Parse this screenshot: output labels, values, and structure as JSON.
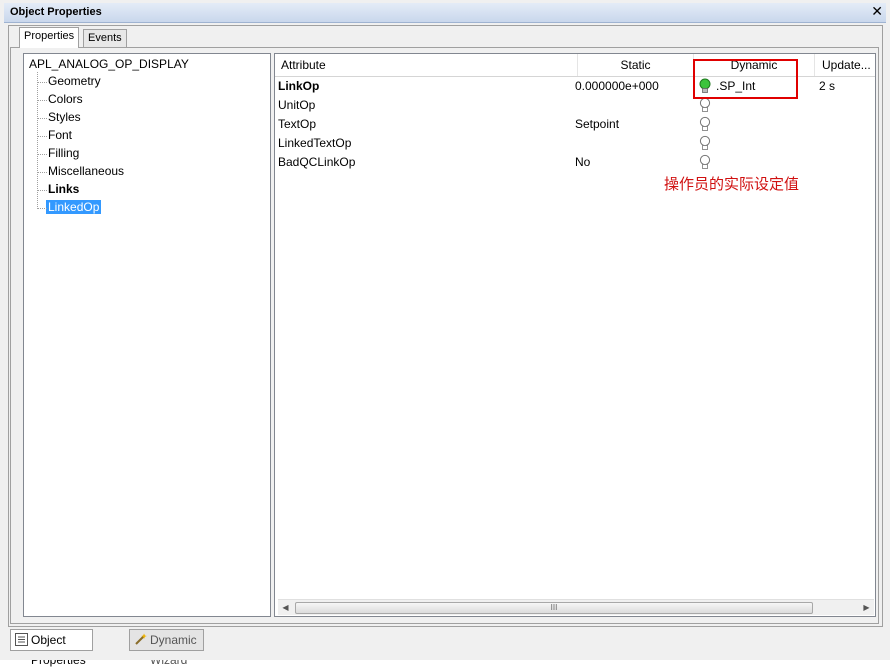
{
  "window": {
    "title": "Object Properties",
    "close_glyph": "✕"
  },
  "tabs": {
    "properties": "Properties",
    "events": "Events"
  },
  "tree": {
    "root": "APL_ANALOG_OP_DISPLAY",
    "items": [
      {
        "label": "Geometry",
        "bold": false,
        "selected": false
      },
      {
        "label": "Colors",
        "bold": false,
        "selected": false
      },
      {
        "label": "Styles",
        "bold": false,
        "selected": false
      },
      {
        "label": "Font",
        "bold": false,
        "selected": false
      },
      {
        "label": "Filling",
        "bold": false,
        "selected": false
      },
      {
        "label": "Miscellaneous",
        "bold": false,
        "selected": false
      },
      {
        "label": "Links",
        "bold": true,
        "selected": false
      },
      {
        "label": "LinkedOp",
        "bold": false,
        "selected": true
      }
    ]
  },
  "grid": {
    "columns": {
      "attribute": "Attribute",
      "static": "Static",
      "dynamic": "Dynamic",
      "update": "Update..."
    },
    "rows": [
      {
        "attribute": "LinkOp",
        "bold": true,
        "static": "0.000000e+000",
        "dynamic": ".SP_Int",
        "bulb": "green-bulb-icon",
        "update": "2 s"
      },
      {
        "attribute": "UnitOp",
        "bold": false,
        "static": "",
        "dynamic": "",
        "bulb": "bulb-icon",
        "update": ""
      },
      {
        "attribute": "TextOp",
        "bold": false,
        "static": "Setpoint",
        "dynamic": "",
        "bulb": "bulb-icon",
        "update": ""
      },
      {
        "attribute": "LinkedTextOp",
        "bold": false,
        "static": "",
        "dynamic": "",
        "bulb": "bulb-icon",
        "update": ""
      },
      {
        "attribute": "BadQCLinkOp",
        "bold": false,
        "static": "No",
        "dynamic": "",
        "bulb": "bulb-icon",
        "update": ""
      }
    ],
    "scrollbar": {
      "grip": "III"
    }
  },
  "annotation": {
    "text": "操作员的实际设定值",
    "color": "#d01010"
  },
  "bottom_tabs": {
    "object_properties": "Object Properties",
    "dynamic_wizard": "Dynamic Wizard"
  },
  "colors": {
    "selection": "#3399ff",
    "highlight_box": "#e00000",
    "active_bulb": "#3cc43c"
  }
}
